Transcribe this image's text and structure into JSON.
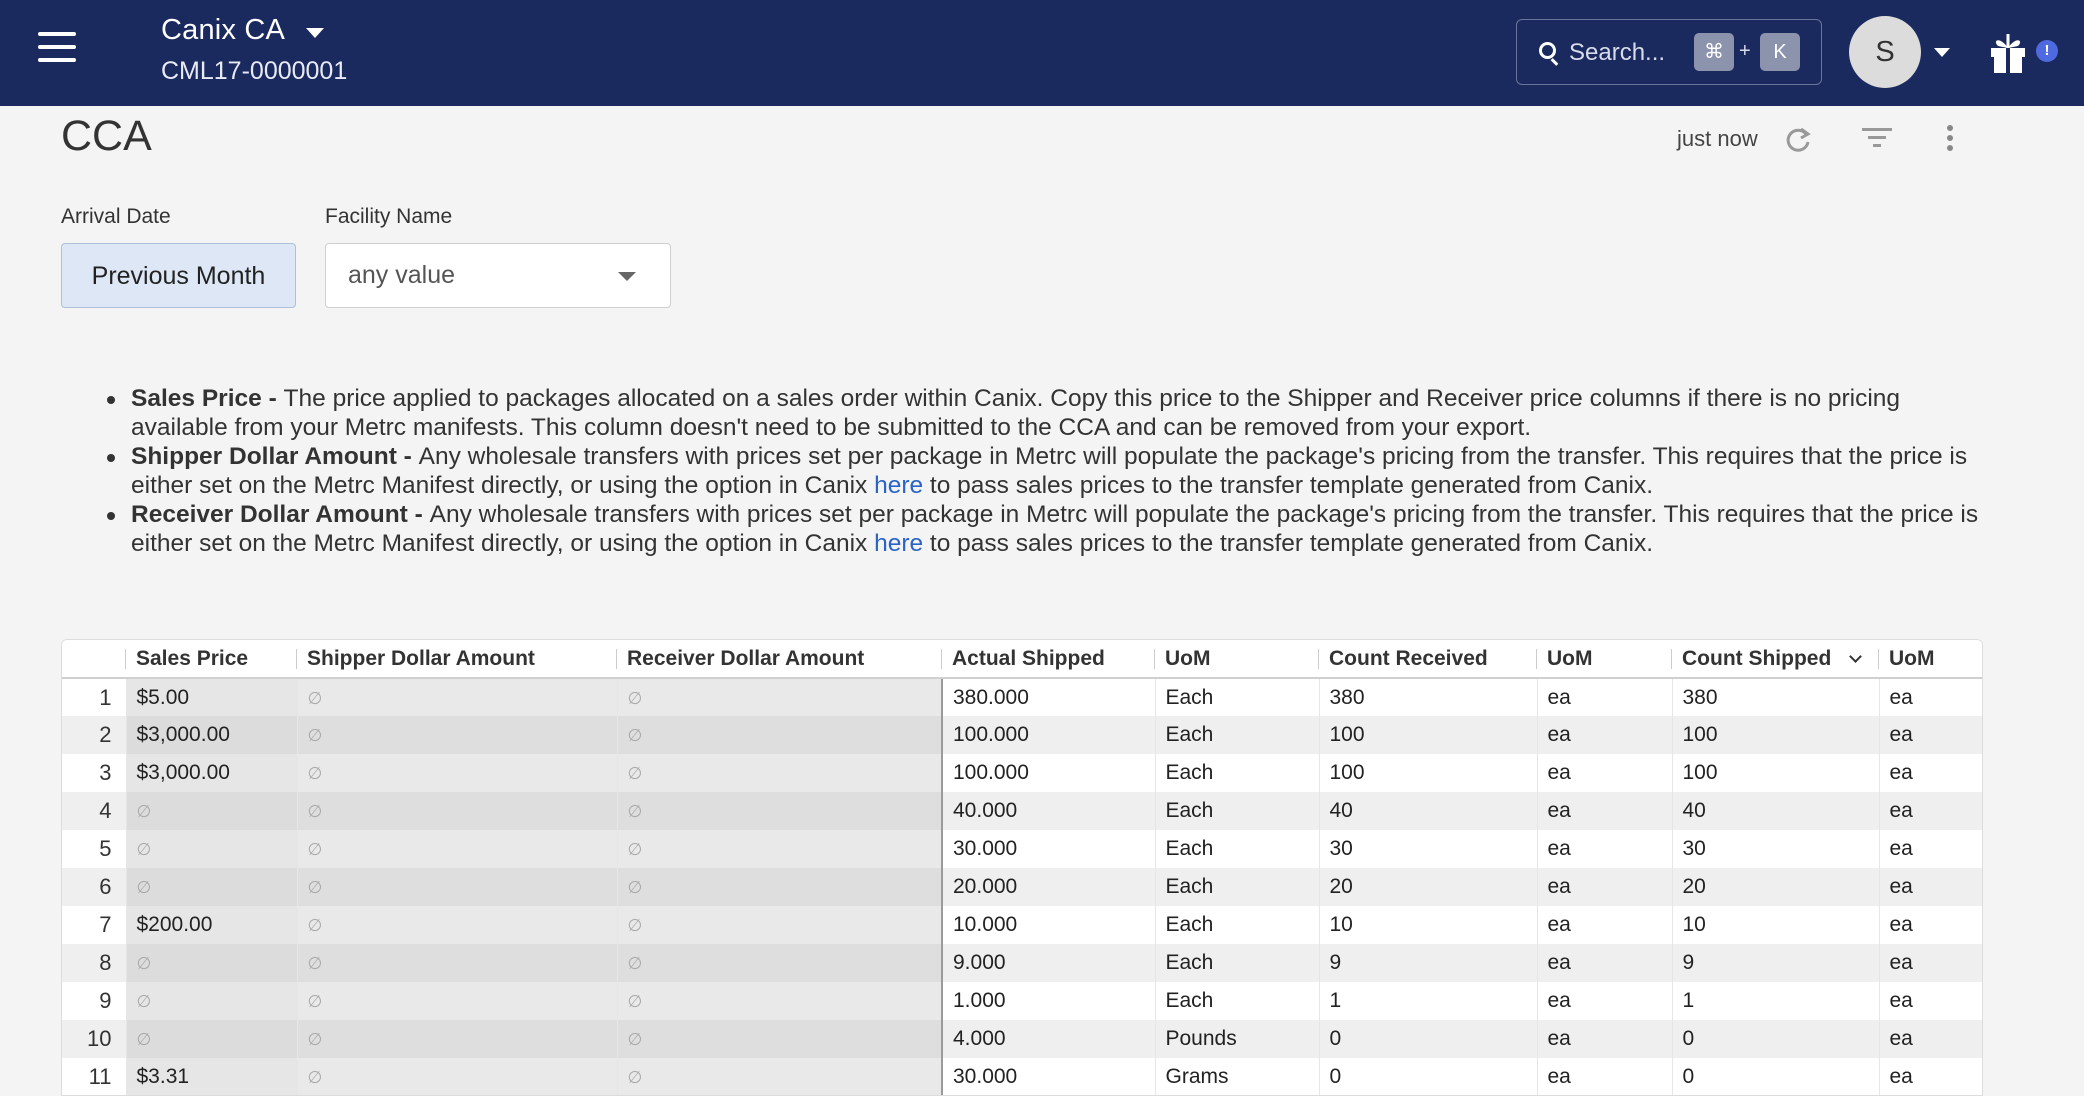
{
  "topbar": {
    "org_name": "Canix CA",
    "license": "CML17-0000001",
    "search_placeholder": "Search...",
    "shortcut_key1": "⌘",
    "shortcut_plus": "+",
    "shortcut_key2": "K",
    "avatar_initial": "S",
    "notification_badge": "!"
  },
  "page": {
    "title": "CCA",
    "updated": "just now"
  },
  "filters": {
    "arrival_label": "Arrival Date",
    "arrival_value": "Previous Month",
    "facility_label": "Facility Name",
    "facility_value": "any value"
  },
  "notes": [
    {
      "term": "Sales Price - ",
      "text": "The price applied to packages allocated on a sales order within Canix. Copy this price to the Shipper and Receiver price columns if there is no pricing available from your Metrc manifests. This column doesn't need to be submitted to the CCA and can be removed from your export."
    },
    {
      "term": "Shipper Dollar Amount - ",
      "text_before": "Any wholesale transfers with prices set per package in Metrc will populate the package's pricing from the transfer. This requires that the price is either set on the Metrc Manifest directly, or using the option in Canix ",
      "link": "here",
      "text_after": " to pass sales prices to the transfer template generated from Canix."
    },
    {
      "term": "Receiver Dollar Amount - ",
      "text_before": "Any wholesale transfers with prices set per package in Metrc will populate the package's pricing from the transfer. This requires that the price is either set on the Metrc Manifest directly, or using the option in Canix ",
      "link": "here",
      "text_after": " to pass sales prices to the transfer template generated from Canix."
    }
  ],
  "table": {
    "null_symbol": "∅",
    "columns": [
      "Sales Price",
      "Shipper Dollar Amount",
      "Receiver Dollar Amount",
      "Actual Shipped",
      "UoM",
      "Count Received",
      "UoM",
      "Count Shipped",
      "UoM"
    ],
    "rows": [
      {
        "n": "1",
        "sales": "$5.00",
        "actual": "380.000",
        "uom1": "Each",
        "count_received": "380",
        "uom2": "ea",
        "count_shipped": "380",
        "uom3": "ea"
      },
      {
        "n": "2",
        "sales": "$3,000.00",
        "actual": "100.000",
        "uom1": "Each",
        "count_received": "100",
        "uom2": "ea",
        "count_shipped": "100",
        "uom3": "ea"
      },
      {
        "n": "3",
        "sales": "$3,000.00",
        "actual": "100.000",
        "uom1": "Each",
        "count_received": "100",
        "uom2": "ea",
        "count_shipped": "100",
        "uom3": "ea"
      },
      {
        "n": "4",
        "sales": "",
        "actual": "40.000",
        "uom1": "Each",
        "count_received": "40",
        "uom2": "ea",
        "count_shipped": "40",
        "uom3": "ea"
      },
      {
        "n": "5",
        "sales": "",
        "actual": "30.000",
        "uom1": "Each",
        "count_received": "30",
        "uom2": "ea",
        "count_shipped": "30",
        "uom3": "ea"
      },
      {
        "n": "6",
        "sales": "",
        "actual": "20.000",
        "uom1": "Each",
        "count_received": "20",
        "uom2": "ea",
        "count_shipped": "20",
        "uom3": "ea"
      },
      {
        "n": "7",
        "sales": "$200.00",
        "actual": "10.000",
        "uom1": "Each",
        "count_received": "10",
        "uom2": "ea",
        "count_shipped": "10",
        "uom3": "ea"
      },
      {
        "n": "8",
        "sales": "",
        "actual": "9.000",
        "uom1": "Each",
        "count_received": "9",
        "uom2": "ea",
        "count_shipped": "9",
        "uom3": "ea"
      },
      {
        "n": "9",
        "sales": "",
        "actual": "1.000",
        "uom1": "Each",
        "count_received": "1",
        "uom2": "ea",
        "count_shipped": "1",
        "uom3": "ea"
      },
      {
        "n": "10",
        "sales": "",
        "actual": "4.000",
        "uom1": "Pounds",
        "count_received": "0",
        "uom2": "ea",
        "count_shipped": "0",
        "uom3": "ea"
      },
      {
        "n": "11",
        "sales": "$3.31",
        "actual": "30.000",
        "uom1": "Grams",
        "count_received": "0",
        "uom2": "ea",
        "count_shipped": "0",
        "uom3": "ea"
      }
    ]
  }
}
